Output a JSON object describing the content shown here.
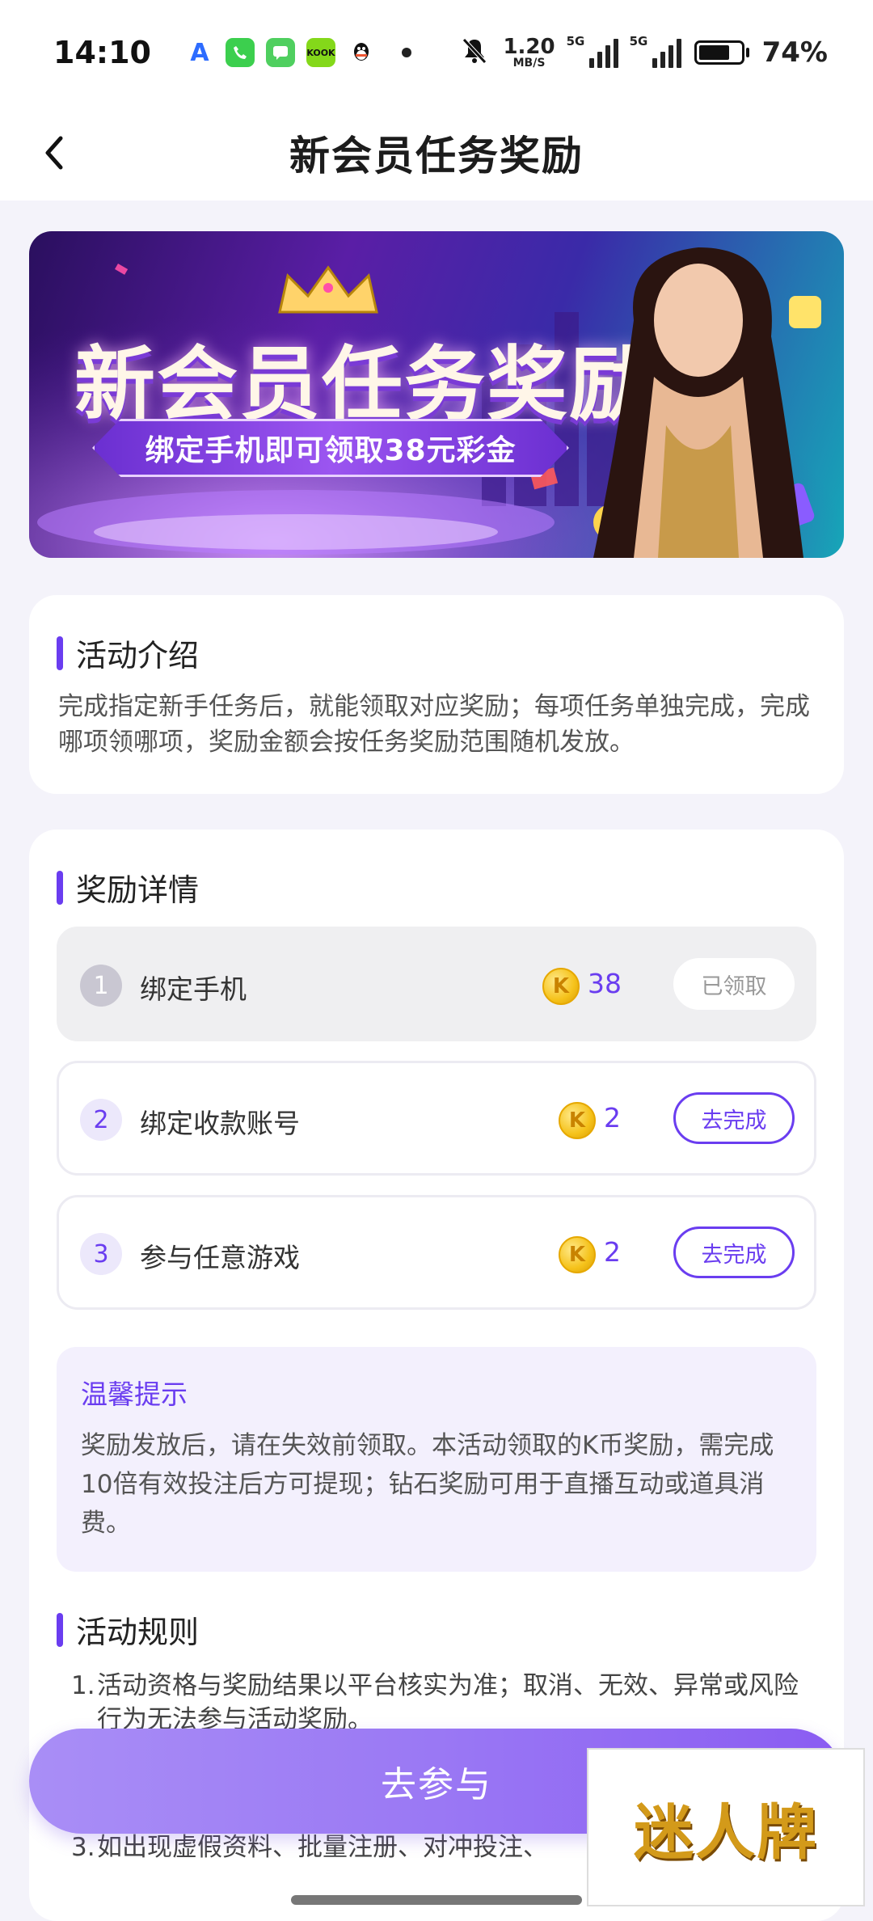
{
  "status_bar": {
    "time": "14:10",
    "net_speed_value": "1.20",
    "net_speed_unit": "MB/S",
    "signal1_label": "5G",
    "signal2_label": "5G",
    "battery_percent": "74%",
    "battery_level": 0.74
  },
  "header": {
    "title": "新会员任务奖励"
  },
  "banner": {
    "title": "新会员任务奖励",
    "subtitle": "绑定手机即可领取38元彩金"
  },
  "intro": {
    "title": "活动介绍",
    "text": "完成指定新手任务后，就能领取对应奖励；每项任务单独完成，完成哪项领哪项，奖励金额会按任务奖励范围随机发放。"
  },
  "rewards": {
    "title": "奖励详情",
    "coin_symbol": "K",
    "tasks": [
      {
        "num": "1",
        "label": "绑定手机",
        "amount": "38",
        "button": "已领取",
        "claimed": true
      },
      {
        "num": "2",
        "label": "绑定收款账号",
        "amount": "2",
        "button": "去完成",
        "claimed": false
      },
      {
        "num": "3",
        "label": "参与任意游戏",
        "amount": "2",
        "button": "去完成",
        "claimed": false
      }
    ]
  },
  "tips": {
    "title": "温馨提示",
    "text": "奖励发放后，请在失效前领取。本活动领取的K币奖励，需完成10倍有效投注后方可提现；钻石奖励可用于直播互动或道具消费。"
  },
  "rules": {
    "title": "活动规则",
    "items": [
      {
        "num": "1.",
        "text": "活动资格与奖励结果以平台核实为准；取消、无效、异常或风险行为无法参与活动奖励。"
      },
      {
        "num": "3.",
        "text": "如出现虚假资料、批量注册、对冲投注、"
      }
    ]
  },
  "cta": {
    "label": "去参与"
  },
  "watermark": {
    "text": "迷人牌"
  },
  "colors": {
    "accent": "#6a3df0",
    "background": "#f4f3fa",
    "coin": "#f5c21a"
  }
}
